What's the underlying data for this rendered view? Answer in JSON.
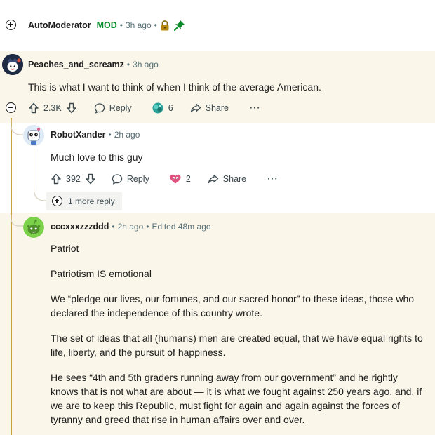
{
  "automod": {
    "author": "AutoModerator",
    "badge": "MOD",
    "time": "3h ago"
  },
  "comment1": {
    "author": "Peaches_and_screamz",
    "time": "3h ago",
    "text": "This is what I want to think of when I think of the average American.",
    "upvotes": "2.3K",
    "reply_label": "Reply",
    "award_count": "6",
    "share_label": "Share",
    "more_label": "···"
  },
  "comment2": {
    "author": "RobotXander",
    "time": "2h ago",
    "text": "Much love to this guy",
    "upvotes": "392",
    "reply_label": "Reply",
    "award_count": "2",
    "share_label": "Share",
    "more_label": "···",
    "more_replies": "1 more reply"
  },
  "comment3": {
    "author": "cccxxxzzzddd",
    "time": "2h ago",
    "edited": "Edited 48m ago",
    "paragraphs": [
      "Patriot",
      "Patriotism IS emotional",
      "We “pledge our lives, our fortunes, and our sacred honor” to these ideas, those who declared the independence of this country wrote.",
      "The set of ideas that all (humans) men are created equal, that we have equal rights to life, liberty, and the pursuit of happiness.",
      "He sees “4th and 5th graders running away from our government” and he rightly knows that is not what are about — it is what we fought against 250 years ago, and, if we are to keep this Republic, must fight for again and again against the forces of tyranny and greed that rise in human affairs over and over."
    ]
  },
  "colors": {
    "highlight_bg": "#faf6ea",
    "mod_green": "#0a8a2a",
    "thread_gold": "#c6a23d"
  },
  "icons": [
    "expand-icon",
    "lock-icon",
    "pin-icon",
    "upvote-icon",
    "downvote-icon",
    "reply-icon",
    "award-icon",
    "share-icon",
    "more-icon",
    "collapse-icon"
  ]
}
